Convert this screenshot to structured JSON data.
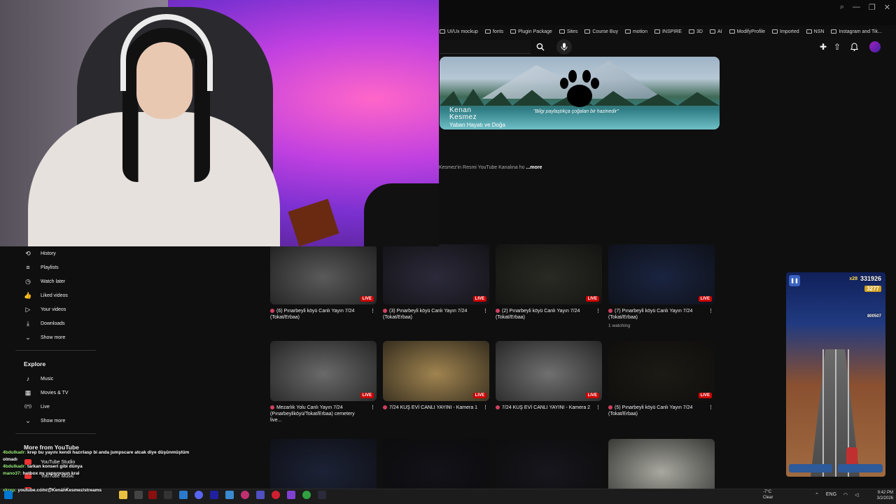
{
  "bookmarks": [
    "UI/Ux mockup",
    "fonts",
    "Plugin Package",
    "Sites",
    "Course Buy",
    "motion",
    "INSPIRE",
    "3D",
    "AI",
    "ModifyProfile",
    "Imported",
    "NSN",
    "Instagram and Tik..."
  ],
  "banner": {
    "name_line1": "Kenan",
    "name_line2": "Kesmez",
    "subtitle": "Yaban Hayatı ve Doğa",
    "quote": "\"Bilgi paylaştıkça çoğalan bir hazinedir\""
  },
  "channel": {
    "description": "Kesmez'in Resmi YouTube Kanalına ho",
    "more_label": "...more"
  },
  "sidebar": {
    "you_items": [
      {
        "label": "History",
        "icon": "history-icon"
      },
      {
        "label": "Playlists",
        "icon": "playlists-icon"
      },
      {
        "label": "Watch later",
        "icon": "watch-later-icon"
      },
      {
        "label": "Liked videos",
        "icon": "liked-videos-icon"
      },
      {
        "label": "Your videos",
        "icon": "your-videos-icon"
      },
      {
        "label": "Downloads",
        "icon": "downloads-icon"
      },
      {
        "label": "Show more",
        "icon": "chevron-down-icon"
      }
    ],
    "explore_heading": "Explore",
    "explore_items": [
      {
        "label": "Music",
        "icon": "music-icon"
      },
      {
        "label": "Movies & TV",
        "icon": "movies-icon"
      },
      {
        "label": "Live",
        "icon": "live-icon"
      },
      {
        "label": "Show more",
        "icon": "chevron-down-icon"
      }
    ],
    "more_heading": "More from YouTube",
    "more_items": [
      {
        "label": "YouTube Studio"
      },
      {
        "label": "YouTube Music"
      },
      {
        "label": "YouTube Kids"
      }
    ]
  },
  "videos": [
    {
      "title": "(6) Pınarbeyli köyü Canlı Yayın 7/24 (Tokat/Erbaa)",
      "live": "LIVE",
      "meta": "",
      "tone": "#5a5a5a"
    },
    {
      "title": "(3) Pınarbeyli köyü Canlı Yayın 7/24 (Tokat/Erbaa)",
      "live": "LIVE",
      "meta": "",
      "tone": "#2c2a3a"
    },
    {
      "title": "(2) Pınarbeyli köyü Canlı Yayın 7/24 (Tokat/Erbaa)",
      "live": "LIVE",
      "meta": "",
      "tone": "#2a2a24"
    },
    {
      "title": "(7) Pınarbeyli köyü Canlı Yayın 7/24 (Tokat/Erbaa)",
      "live": "LIVE",
      "meta": "1 watching",
      "tone": "#1a2440"
    },
    {
      "title": "Mezarlık Yolu Canlı Yayın 7/24 (Pınarbeyliköyü/Tokat/Erbaa) cemetery live...",
      "live": "LIVE",
      "meta": "",
      "tone": "#6a6a6a"
    },
    {
      "title": "7/24 KUŞ EVİ CANLI YAYINI - Kamera 1",
      "live": "LIVE",
      "meta": "",
      "tone": "#a08450"
    },
    {
      "title": "7/24 KUŞ EVİ CANLI YAYINI - Kamera 2",
      "live": "LIVE",
      "meta": "",
      "tone": "#707070"
    },
    {
      "title": "(5) Pınarbeyli köyü Canlı Yayın 7/24 (Tokat/Erbaa)",
      "live": "LIVE",
      "meta": "",
      "tone": "#1c1a14"
    },
    {
      "title": "",
      "live": "",
      "meta": "",
      "tone": "#1c2236"
    },
    {
      "title": "",
      "live": "",
      "meta": "",
      "tone": "#121218"
    },
    {
      "title": "",
      "live": "",
      "meta": "",
      "tone": "#16161c"
    },
    {
      "title": "",
      "live": "",
      "meta": "",
      "tone": "#a8a8a0"
    }
  ],
  "chat": [
    {
      "user": "4bdulkadr:",
      "text": "krep bu yayını kendi hazırlasp bi anda jumpscare atcak diye düşünmüştüm olmadı"
    },
    {
      "user": "4bdulkadr:",
      "text": "tarkan konseri gibi dünya"
    },
    {
      "user": "mano37:",
      "text": "hotbox mı yapıyorsun kral"
    }
  ],
  "url_overlay": {
    "user": "xkrep:",
    "text": "youtube.com/@KenanKesmez/streams"
  },
  "game": {
    "score": "331926",
    "multiplier": "x28",
    "coins": "3277",
    "high_score": "800507"
  },
  "taskbar": {
    "weather_temp": "-7°C",
    "weather_desc": "Clear",
    "lang": "ENG",
    "time": "9:42 PM",
    "date": "3/2/2026"
  }
}
